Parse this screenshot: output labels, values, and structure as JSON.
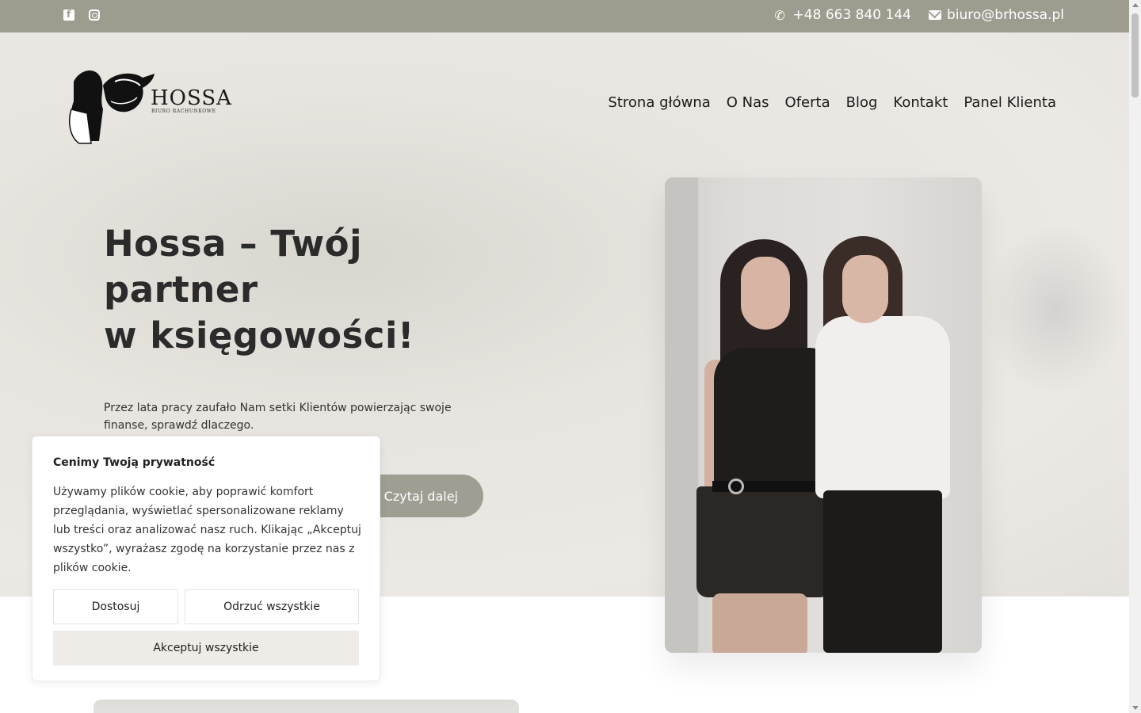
{
  "topbar": {
    "icons": [
      "facebook-icon",
      "instagram-icon",
      "phone-icon",
      "mail-icon"
    ],
    "phone": "+48 663 840 144",
    "email": "biuro@brhossa.pl"
  },
  "logo": {
    "name": "HOSSA",
    "subtitle": "BIURO RACHUNKOWE"
  },
  "nav": {
    "items": [
      "Strona główna",
      "O Nas",
      "Oferta",
      "Blog",
      "Kontakt",
      "Panel Klienta"
    ]
  },
  "hero": {
    "title_line1": "Hossa – Twój",
    "title_line2": "partner",
    "title_line3": "w księgowości!",
    "description": "Przez lata pracy zaufało Nam setki Klientów powierzając swoje finanse, sprawdź dlaczego.",
    "cta_label": "Czytaj dalej"
  },
  "cookie": {
    "title": "Cenimy Twoją prywatność",
    "text": "Używamy plików cookie, aby poprawić komfort przeglądania, wyświetlać spersonalizowane reklamy lub treści oraz analizować nasz ruch. Klikając „Akceptuj wszystko”, wyrażasz zgodę na korzystanie przez nas z plików cookie.",
    "customize_label": "Dostosuj",
    "reject_label": "Odrzuć wszystkie",
    "accept_label": "Akceptuj wszystkie"
  },
  "colors": {
    "topbar_bg": "#9e9c8f",
    "cta_bg": "#a09e93",
    "accept_bg": "#efebe7"
  }
}
